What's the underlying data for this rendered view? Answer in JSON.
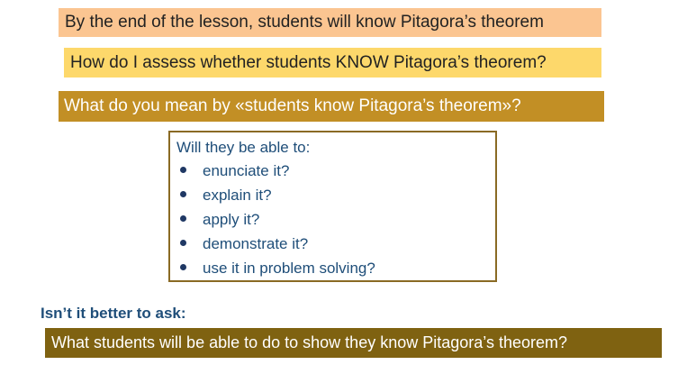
{
  "bands": {
    "objective": "By the end of the lesson, students will know Pitagora’s theorem",
    "assess_question": "How do I assess whether students KNOW Pitagora’s theorem?",
    "meaning_question": "What do you mean by «students know Pitagora’s theorem»?"
  },
  "checklist": {
    "intro": "Will they be able to:",
    "items": [
      "enunciate it?",
      "explain it?",
      "apply it?",
      "demonstrate it?",
      "use it in problem solving?"
    ]
  },
  "closing": {
    "question": "Isn’t it better to ask:",
    "answer": "What students will be able to do to show they know Pitagora’s theorem?"
  },
  "colors": {
    "band_peach": "#fbc591",
    "band_yellow": "#fdd86b",
    "band_gold": "#c28f25",
    "band_brown": "#7f6211",
    "text_blue": "#1f4e79",
    "box_border": "#8a6a24"
  }
}
